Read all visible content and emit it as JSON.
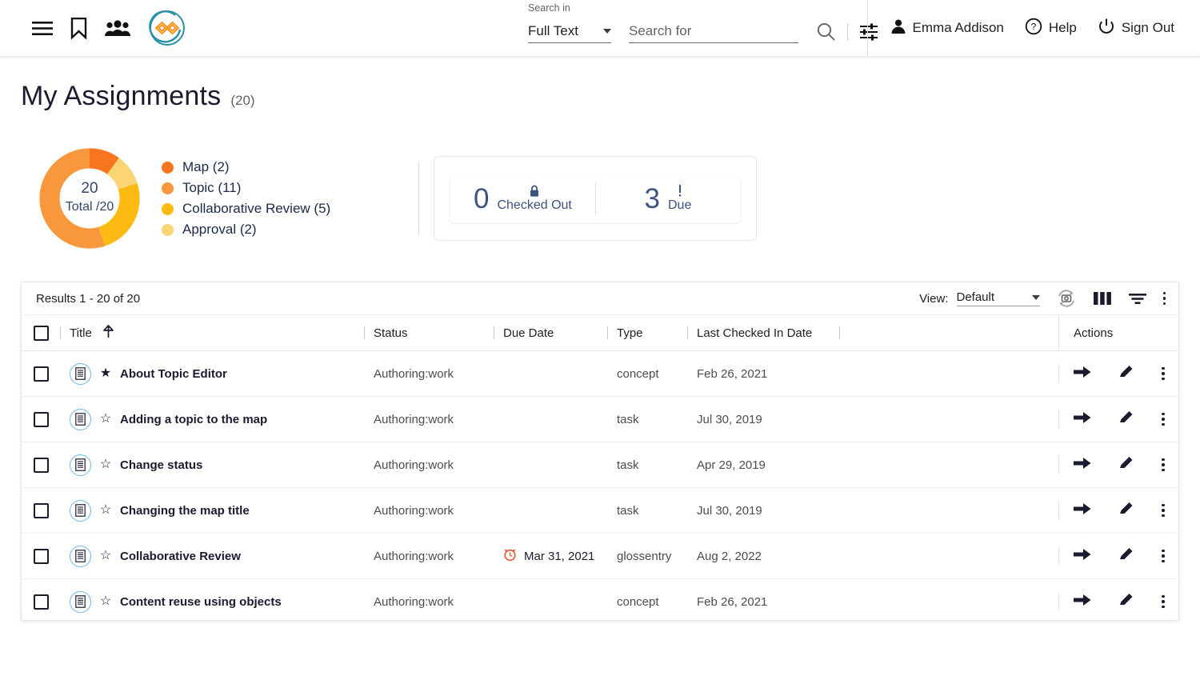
{
  "header": {
    "icons": {
      "menu": "hamburger-menu-icon",
      "bookmark": "bookmark-icon",
      "people": "people-group-icon",
      "logo": "app-logo-icon"
    },
    "search": {
      "search_in_label": "Search in",
      "scope_value": "Full Text",
      "query_value": "",
      "query_placeholder": "Search for",
      "search_icon": "search-icon",
      "advanced_icon": "advanced-search-settings-icon"
    },
    "user": {
      "name": "Emma Addison",
      "icon": "person-icon"
    },
    "help": {
      "label": "Help",
      "icon": "help-circle-icon"
    },
    "signout": {
      "label": "Sign Out",
      "icon": "power-icon"
    }
  },
  "page": {
    "title": "My Assignments",
    "count": "(20)"
  },
  "chart_data": {
    "type": "pie",
    "title": "My Assignments",
    "center_value": "20",
    "center_label": "Total /20",
    "total": 20,
    "legend_position": "right",
    "categories": [
      "Map",
      "Topic",
      "Collaborative Review",
      "Approval"
    ],
    "values": [
      2,
      11,
      5,
      2
    ],
    "colors": [
      "#F7751F",
      "#F9973C",
      "#FDBA12",
      "#FBD473"
    ],
    "legend": [
      {
        "label": "Map (2)",
        "color": "#F7751F"
      },
      {
        "label": "Topic (11)",
        "color": "#F9973C"
      },
      {
        "label": "Collaborative Review (5)",
        "color": "#FDBA12"
      },
      {
        "label": "Approval (2)",
        "color": "#FBD473"
      }
    ]
  },
  "stats": [
    {
      "value": "0",
      "label": "Checked Out",
      "icon": "lock-icon"
    },
    {
      "value": "3",
      "label": "Due",
      "icon": "exclamation-icon"
    }
  ],
  "table": {
    "results_text": "Results 1 - 20 of 20",
    "view_label": "View:",
    "view_value": "Default",
    "toolbar_icons": {
      "refresh": "refresh-snapshot-icon",
      "columns": "columns-icon",
      "filter": "filter-icon",
      "more": "more-vertical-icon"
    },
    "columns": [
      {
        "key": "title",
        "label": "Title",
        "sort": "asc"
      },
      {
        "key": "status",
        "label": "Status"
      },
      {
        "key": "due",
        "label": "Due Date"
      },
      {
        "key": "type",
        "label": "Type"
      },
      {
        "key": "lcid",
        "label": "Last Checked In Date"
      },
      {
        "key": "spare",
        "label": ""
      },
      {
        "key": "actions",
        "label": "Actions"
      }
    ],
    "rows": [
      {
        "title": "About Topic Editor",
        "starred": true,
        "status": "Authoring:work",
        "due": "",
        "due_overdue": false,
        "type": "concept",
        "lcid": "Feb 26, 2021"
      },
      {
        "title": "Adding a topic to the map",
        "starred": false,
        "status": "Authoring:work",
        "due": "",
        "due_overdue": false,
        "type": "task",
        "lcid": "Jul 30, 2019"
      },
      {
        "title": "Change status",
        "starred": false,
        "status": "Authoring:work",
        "due": "",
        "due_overdue": false,
        "type": "task",
        "lcid": "Apr 29, 2019"
      },
      {
        "title": "Changing the map title",
        "starred": false,
        "status": "Authoring:work",
        "due": "",
        "due_overdue": false,
        "type": "task",
        "lcid": "Jul 30, 2019"
      },
      {
        "title": "Collaborative Review",
        "starred": false,
        "status": "Authoring:work",
        "due": "Mar 31, 2021",
        "due_overdue": true,
        "type": "glossentry",
        "lcid": "Aug 2, 2022"
      },
      {
        "title": "Content reuse using objects",
        "starred": false,
        "status": "Authoring:work",
        "due": "",
        "due_overdue": false,
        "type": "concept",
        "lcid": "Feb 26, 2021"
      }
    ],
    "row_action_icons": {
      "go": "arrow-right-icon",
      "edit": "pencil-icon",
      "more": "more-vertical-icon"
    }
  },
  "colors": {
    "accent_orange": "#F7751F",
    "accent_teal": "#2b8fa8",
    "overdue_red": "#E8532B",
    "stat_blue": "#3c5481",
    "doc_icon_blue": "#6cb6e8"
  }
}
